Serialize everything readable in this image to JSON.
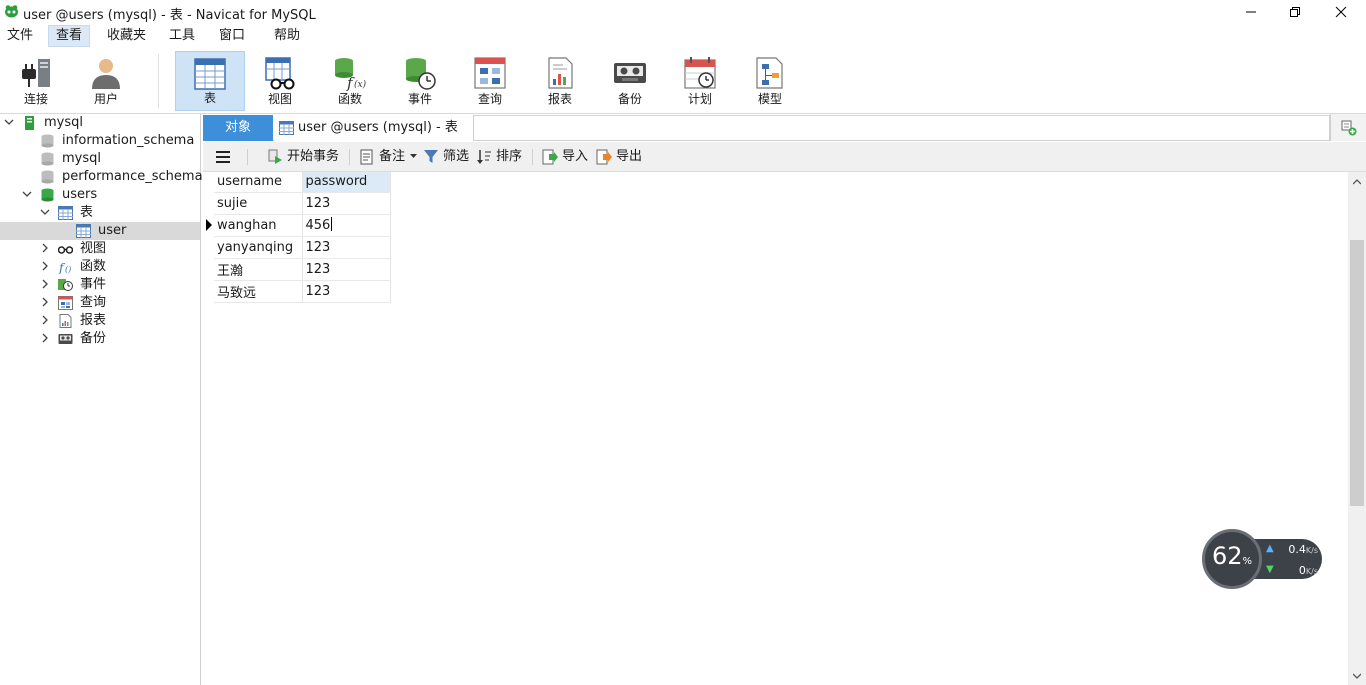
{
  "window": {
    "title": "user @users (mysql) - 表 - Navicat for MySQL"
  },
  "menu": [
    "文件",
    "查看",
    "收藏夹",
    "工具",
    "窗口",
    "帮助"
  ],
  "toolbar": [
    {
      "label": "连接"
    },
    {
      "label": "用户"
    },
    {
      "label": "表"
    },
    {
      "label": "视图"
    },
    {
      "label": "函数"
    },
    {
      "label": "事件"
    },
    {
      "label": "查询"
    },
    {
      "label": "报表"
    },
    {
      "label": "备份"
    },
    {
      "label": "计划"
    },
    {
      "label": "模型"
    }
  ],
  "tree": {
    "connection": "mysql",
    "databases": [
      "information_schema",
      "mysql",
      "performance_schema",
      "users"
    ],
    "users_children": {
      "tables": "表",
      "table_item": "user",
      "views": "视图",
      "functions": "函数",
      "events": "事件",
      "queries": "查询",
      "reports": "报表",
      "backups": "备份"
    }
  },
  "tabs": {
    "objects": "对象",
    "table_tab": "user @users (mysql) - 表"
  },
  "data_toolbar": {
    "begin_transaction": "开始事务",
    "memo": "备注",
    "filter": "筛选",
    "sort": "排序",
    "import": "导入",
    "export": "导出"
  },
  "grid": {
    "columns": [
      "username",
      "password"
    ],
    "rows": [
      [
        "sujie",
        "123"
      ],
      [
        "wanghan",
        "456"
      ],
      [
        "yanyanqing",
        "123"
      ],
      [
        "王瀚",
        "123"
      ],
      [
        "马致远",
        "123"
      ]
    ]
  },
  "network": {
    "percent": "62",
    "percent_unit": "%",
    "up": "0.4",
    "down": "0",
    "unit": "K/s"
  },
  "colors": {
    "accent": "#3d8fd9",
    "active_tool": "#cfe3f7"
  }
}
